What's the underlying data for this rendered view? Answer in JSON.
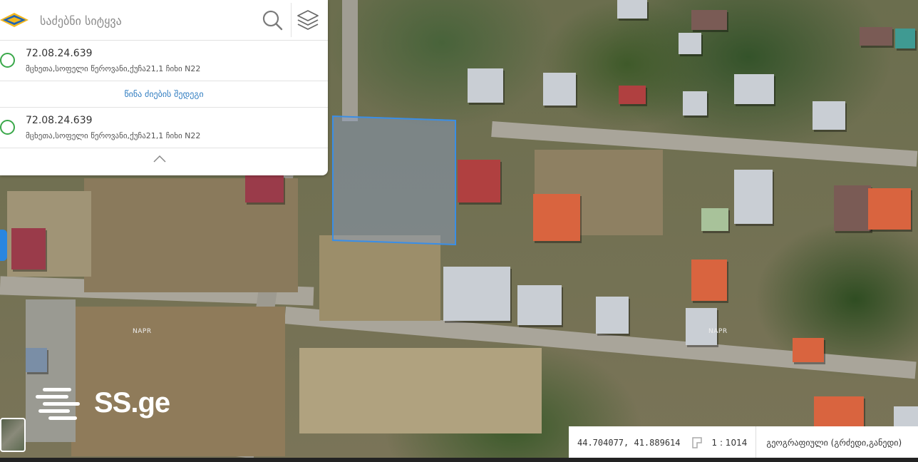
{
  "search": {
    "placeholder": "საძებნი სიტყვა"
  },
  "results": [
    {
      "code": "72.08.24.639",
      "address": "მცხეთა,სოფელი წეროვანი,ქუჩა21,1 ჩიხი N22"
    },
    {
      "code": "72.08.24.639",
      "address": "მცხეთა,სოფელი წეროვანი,ქუჩა21,1 ჩიხი N22"
    }
  ],
  "previous_search_label": "წინა ძიების შედეგი",
  "map": {
    "labels": [
      "NAPR",
      "NAPR"
    ],
    "watermark": "SS.ge"
  },
  "status": {
    "coordinates": "44.704077, 41.889614",
    "scale": "1 : 1014",
    "crs": "გეოგრაფიული (გრძედი,განედი)"
  },
  "colors": {
    "accent": "#2f7cc0",
    "radio": "#3aa84a",
    "parcel": "#3a8ee6"
  }
}
